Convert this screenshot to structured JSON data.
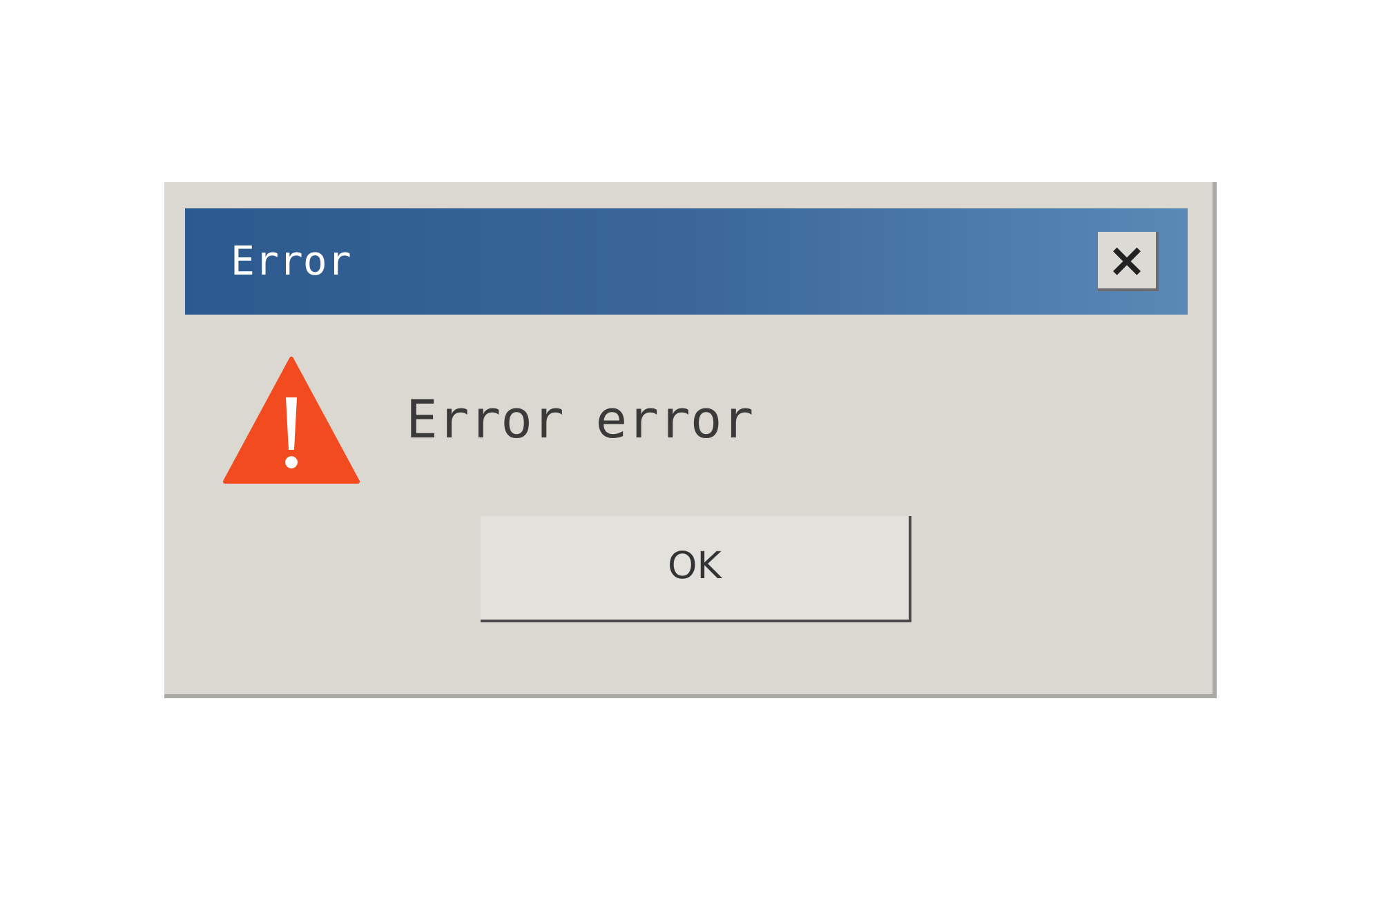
{
  "window": {
    "title": "Error"
  },
  "close_button": {
    "label": "×"
  },
  "message": "Error error",
  "buttons": [
    "OK"
  ]
}
